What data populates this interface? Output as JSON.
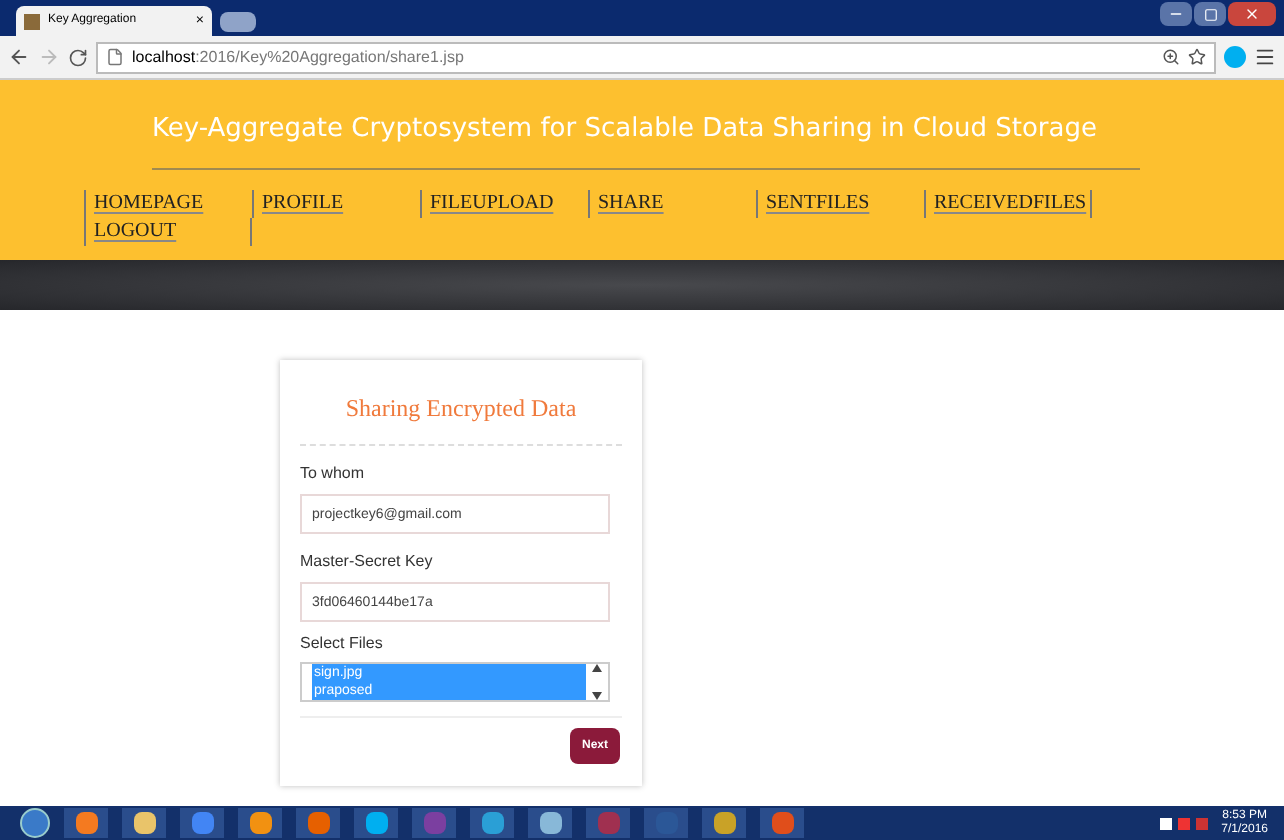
{
  "browser": {
    "tab_title": "Key Aggregation",
    "tab_close": "×",
    "url_host": "localhost",
    "url_path": ":2016/Key%20Aggregation/share1.jsp"
  },
  "header": {
    "title": "Key-Aggregate Cryptosystem for Scalable Data Sharing in Cloud Storage"
  },
  "nav": [
    {
      "label": "HOMEPAGE"
    },
    {
      "label": "PROFILE"
    },
    {
      "label": "FILEUPLOAD"
    },
    {
      "label": "SHARE"
    },
    {
      "label": "SENTFILES"
    },
    {
      "label": "RECEIVEDFILES"
    },
    {
      "label": "LOGOUT"
    }
  ],
  "form": {
    "title": "Sharing Encrypted Data",
    "fields": [
      {
        "label": "To whom",
        "value": "projectkey6@gmail.com"
      },
      {
        "label": "Master-Secret Key",
        "value": "3fd06460144be17a"
      }
    ],
    "files": {
      "label": "Select Files",
      "options": [
        {
          "label": "sign.jpg",
          "selected": true
        },
        {
          "label": "praposed",
          "selected": true
        }
      ]
    },
    "button": "Next"
  },
  "taskbar": {
    "time": "8:53 PM",
    "date": "7/1/2016"
  }
}
